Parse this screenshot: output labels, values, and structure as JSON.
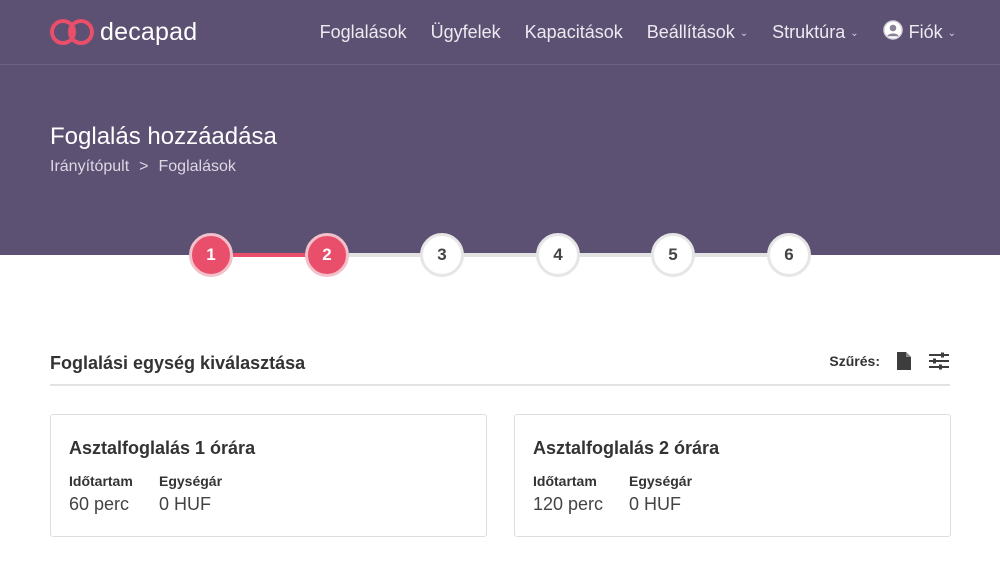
{
  "brand": {
    "name": "decapad",
    "logo_color": "#e94e6b"
  },
  "nav": {
    "items": [
      {
        "label": "Foglalások",
        "dropdown": false
      },
      {
        "label": "Ügyfelek",
        "dropdown": false
      },
      {
        "label": "Kapacitások",
        "dropdown": false
      },
      {
        "label": "Beállítások",
        "dropdown": true
      },
      {
        "label": "Struktúra",
        "dropdown": true
      },
      {
        "label": "Fiók",
        "dropdown": true,
        "icon": "user-circle-icon"
      }
    ],
    "chevron": "⌄"
  },
  "colors": {
    "header_bg": "#5c5073",
    "accent": "#e94e6b"
  },
  "page": {
    "title": "Foglalás hozzáadása",
    "breadcrumb": [
      "Irányítópult",
      "Foglalások"
    ],
    "breadcrumb_separator": ">"
  },
  "stepper": {
    "steps": [
      "1",
      "2",
      "3",
      "4",
      "5",
      "6"
    ],
    "current_step": 2
  },
  "section": {
    "title": "Foglalási egység kiválasztása",
    "filter_label": "Szűrés:",
    "icons": [
      "document-icon",
      "sliders-icon"
    ]
  },
  "cards": [
    {
      "title": "Asztalfoglalás 1 órára",
      "duration_label": "Időtartam",
      "duration_value": "60 perc",
      "price_label": "Egységár",
      "price_value": "0 HUF"
    },
    {
      "title": "Asztalfoglalás 2 órára",
      "duration_label": "Időtartam",
      "duration_value": "120 perc",
      "price_label": "Egységár",
      "price_value": "0 HUF"
    }
  ]
}
